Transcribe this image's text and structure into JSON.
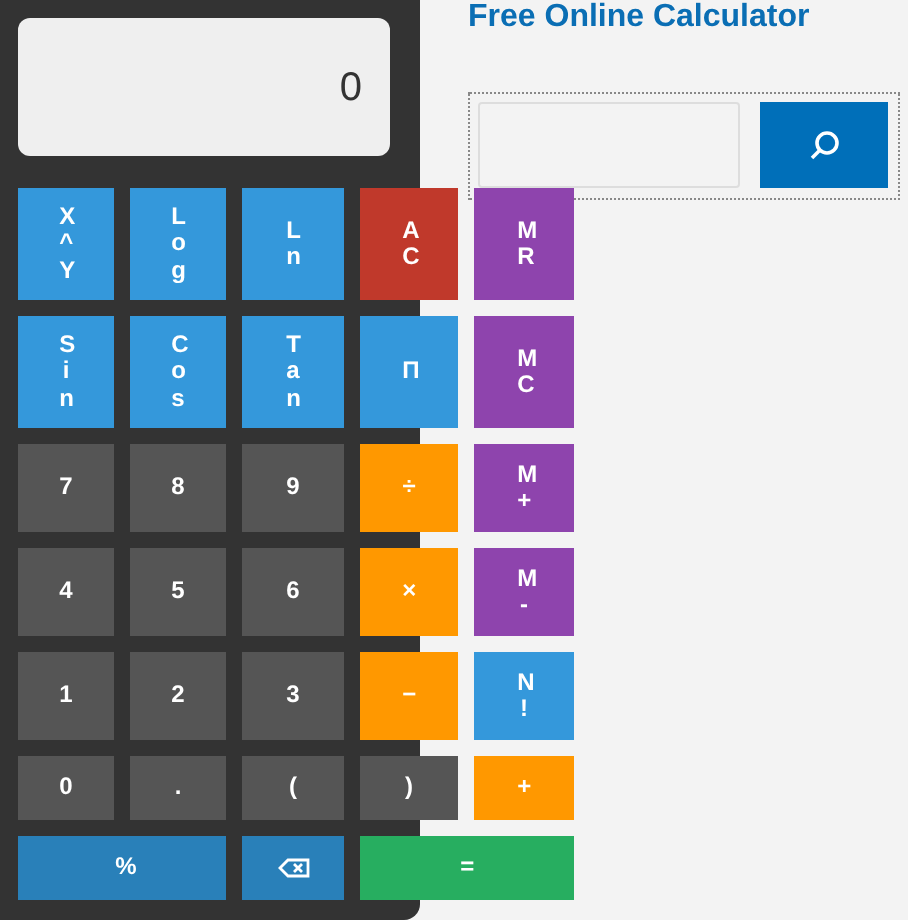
{
  "display": {
    "value": "0"
  },
  "keys": [
    {
      "label": "X^Y",
      "kind": "sci"
    },
    {
      "label": "Log",
      "kind": "sci"
    },
    {
      "label": "Ln",
      "kind": "sci"
    },
    {
      "label": "AC",
      "kind": "clear"
    },
    {
      "label": "MR",
      "kind": "memory"
    },
    {
      "label": "Sin",
      "kind": "sci"
    },
    {
      "label": "Cos",
      "kind": "sci"
    },
    {
      "label": "Tan",
      "kind": "sci"
    },
    {
      "label": "Π",
      "kind": "sci"
    },
    {
      "label": "MC",
      "kind": "memory"
    },
    {
      "label": "7",
      "kind": "digit"
    },
    {
      "label": "8",
      "kind": "digit"
    },
    {
      "label": "9",
      "kind": "digit"
    },
    {
      "label": "÷",
      "kind": "operator"
    },
    {
      "label": "M+",
      "kind": "memory"
    },
    {
      "label": "4",
      "kind": "digit"
    },
    {
      "label": "5",
      "kind": "digit"
    },
    {
      "label": "6",
      "kind": "digit"
    },
    {
      "label": "×",
      "kind": "operator"
    },
    {
      "label": "M-",
      "kind": "memory"
    },
    {
      "label": "1",
      "kind": "digit"
    },
    {
      "label": "2",
      "kind": "digit"
    },
    {
      "label": "3",
      "kind": "digit"
    },
    {
      "label": "−",
      "kind": "operator"
    },
    {
      "label": "N!",
      "kind": "sci"
    },
    {
      "label": "0",
      "kind": "digit"
    },
    {
      "label": ".",
      "kind": "digit"
    },
    {
      "label": "(",
      "kind": "digit"
    },
    {
      "label": ")",
      "kind": "digit"
    },
    {
      "label": "+",
      "kind": "operator"
    },
    {
      "label": "%",
      "kind": "percent",
      "wide": true
    },
    {
      "kind": "backspace"
    },
    {
      "label": "=",
      "kind": "equals",
      "wide": true
    }
  ],
  "title": "Free Online Calculator"
}
